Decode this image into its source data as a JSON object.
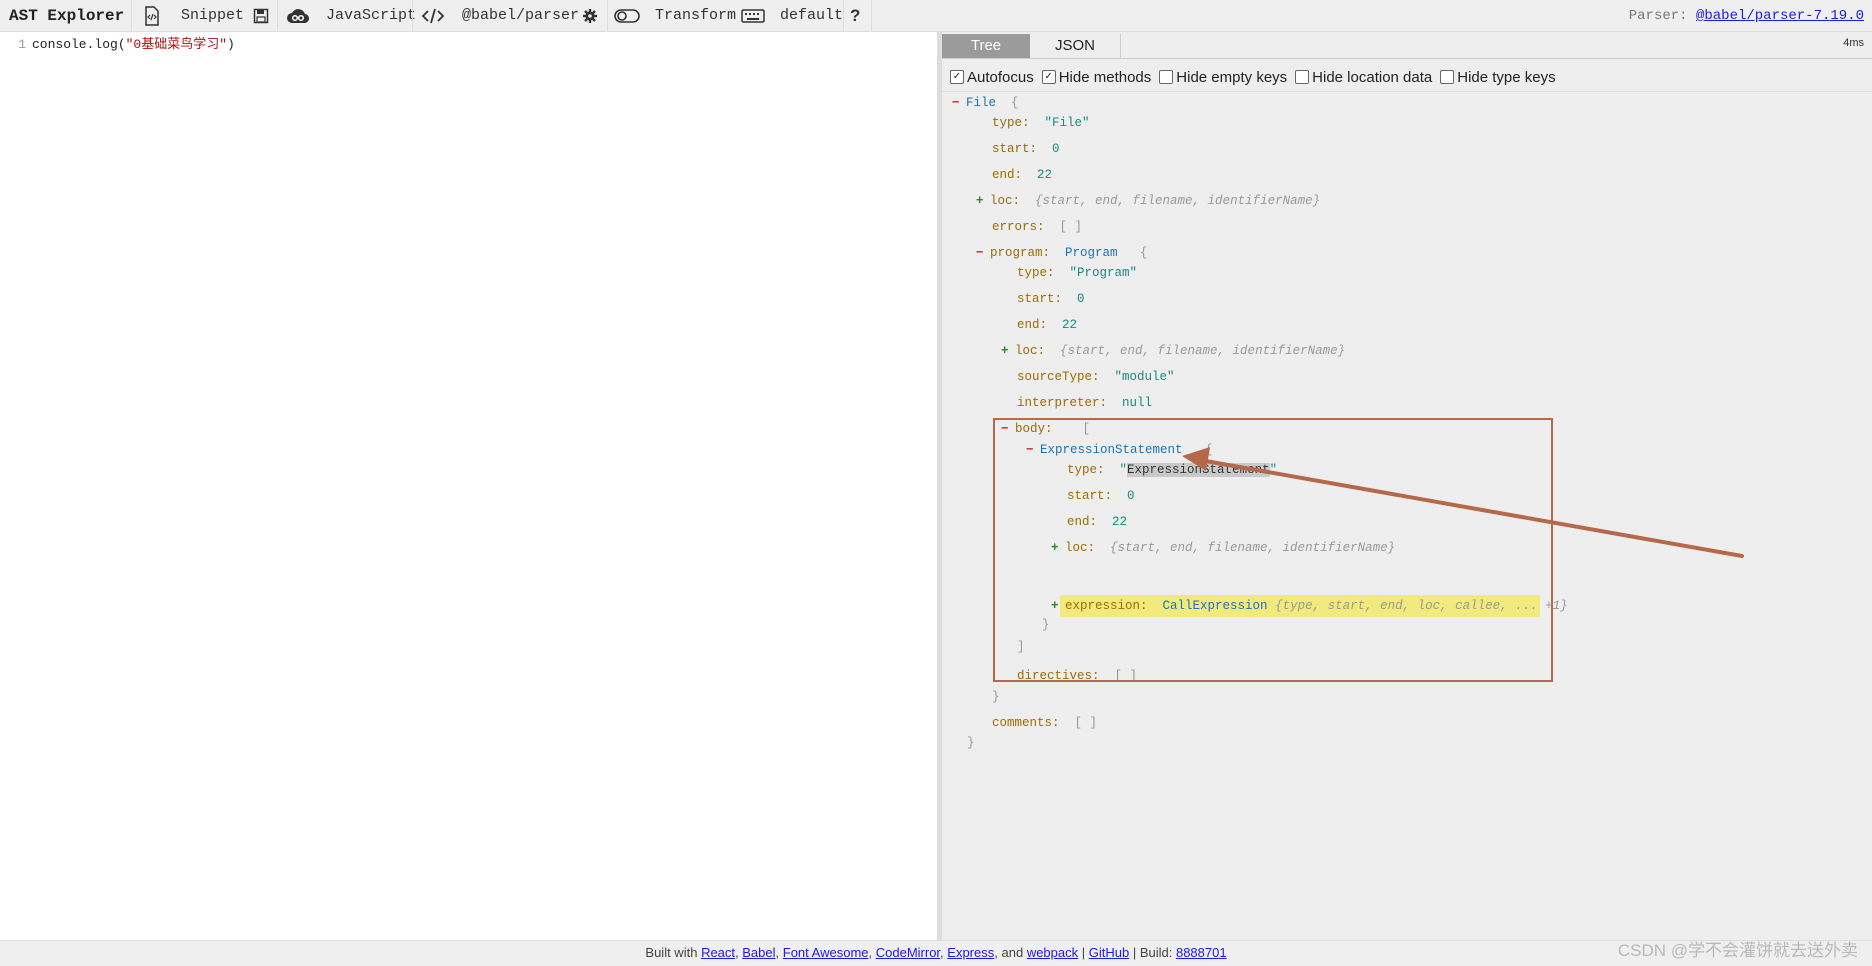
{
  "toolbar": {
    "title": "AST Explorer",
    "snippet": "Snippet",
    "language": "JavaScript",
    "parser": "@babel/parser",
    "transform": "Transform",
    "keymap": "default",
    "help": "?",
    "parser_info_label": "Parser:",
    "parser_info_link": "@babel/parser-7.19.0"
  },
  "editor": {
    "line_number": "1",
    "code_prefix": "console.log(",
    "code_string": "\"0基础菜鸟学习\"",
    "code_suffix": ")"
  },
  "output": {
    "tabs": [
      "Tree",
      "JSON"
    ],
    "active_tab": "Tree",
    "time": "4ms",
    "options": [
      {
        "label": "Autofocus",
        "checked": true
      },
      {
        "label": "Hide methods",
        "checked": true
      },
      {
        "label": "Hide empty keys",
        "checked": false
      },
      {
        "label": "Hide location data",
        "checked": false
      },
      {
        "label": "Hide type keys",
        "checked": false
      }
    ]
  },
  "tree": {
    "file_type": "File",
    "loc_summary": "{start, end, filename, identifierName}",
    "keys": {
      "type": "type:",
      "start": "start:",
      "end": "end:",
      "loc": "loc:",
      "errors": "errors:",
      "program": "program:",
      "sourceType": "sourceType:",
      "interpreter": "interpreter:",
      "body": "body:",
      "expression": "expression:",
      "directives": "directives:",
      "comments": "comments:"
    },
    "values": {
      "file_type_str": "\"File\"",
      "zero": "0",
      "end_value": "22",
      "empty_array": "[ ]",
      "program_type": "Program",
      "program_type_str": "\"Program\"",
      "source_type": "\"module\"",
      "null": "null",
      "expr_stmt": "ExpressionStatement",
      "expr_stmt_str": "ExpressionStatement",
      "call_expr": "CallExpression",
      "call_summary": "{type, start, end, loc, callee, ... +1}"
    }
  },
  "footer": {
    "built_with": "Built with",
    "react": "React",
    "babel": "Babel",
    "font_awesome": "Font Awesome",
    "codemirror": "CodeMirror",
    "express": "Express",
    "and": "and",
    "webpack": "webpack",
    "github": "GitHub",
    "build_label": "Build:",
    "build_hash": "8888701"
  },
  "watermark": "CSDN @学不会灌饼就去送外卖",
  "colors": {
    "annotation": "#b5694a",
    "highlight": "#f3ea7e",
    "active_tab": "#9b9b9b"
  }
}
